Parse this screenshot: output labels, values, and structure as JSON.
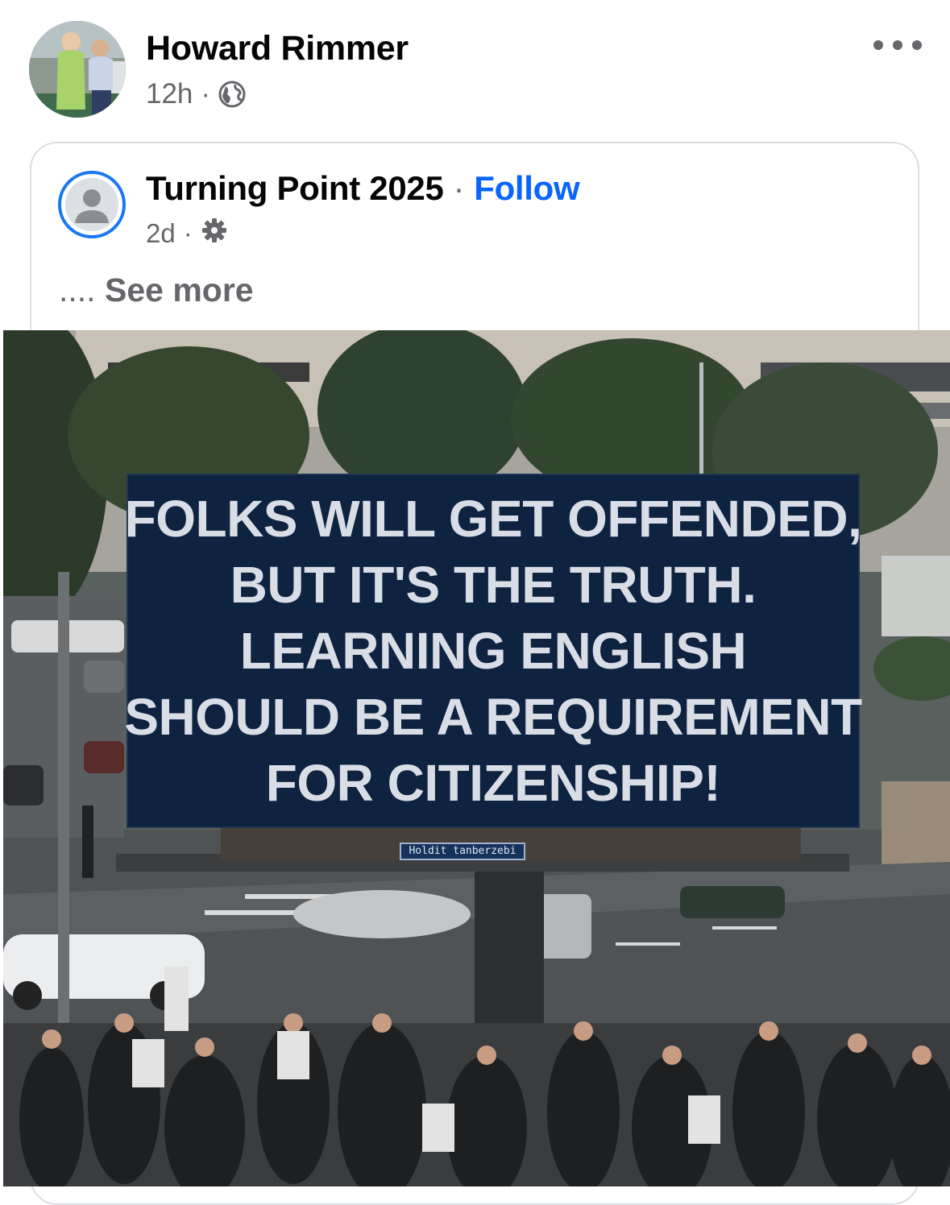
{
  "post": {
    "author_name": "Howard Rimmer",
    "timestamp": "12h",
    "separator": "·",
    "audience_icon": "globe-icon",
    "more_icon": "more-options-icon"
  },
  "shared_post": {
    "page_name": "Turning Point 2025",
    "separator": "·",
    "follow_label": "Follow",
    "timestamp": "2d",
    "audience_icon": "gear-icon",
    "ellipsis": "....",
    "see_more_label": "See more",
    "image": {
      "billboard_lines": [
        "FOLKS WILL GET OFFENDED,",
        "BUT IT'S THE TRUTH.",
        "LEARNING ENGLISH",
        "SHOULD BE A REQUIREMENT",
        "FOR CITIZENSHIP!"
      ],
      "billboard_plate": "Holdit tanberzebi"
    }
  },
  "colors": {
    "link_blue": "#0866ff",
    "ring_blue": "#1877f2",
    "secondary_text": "#65676b",
    "billboard_bg": "#0e2340"
  }
}
